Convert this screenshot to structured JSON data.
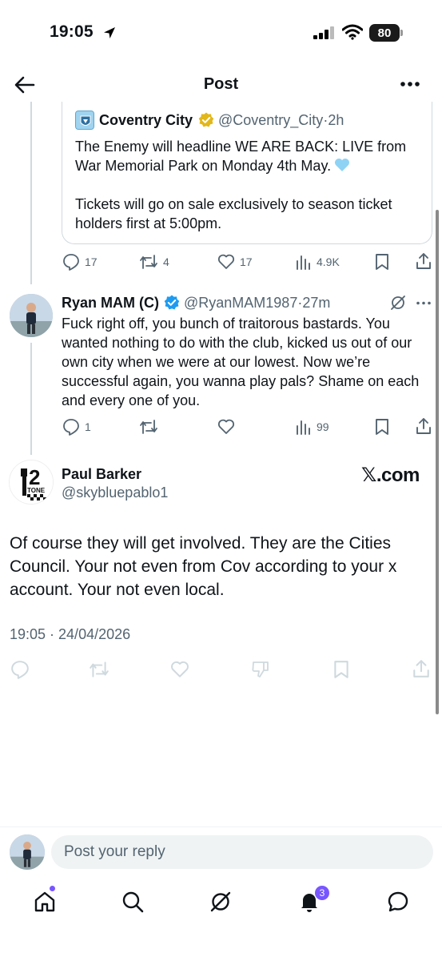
{
  "status_bar": {
    "time": "19:05",
    "battery": "80"
  },
  "header": {
    "title": "Post"
  },
  "quoted_tweet": {
    "name": "Coventry City",
    "handle": "@Coventry_City",
    "age": "2h",
    "paragraph1": "The Enemy will headline WE ARE BACK: LIVE from War Memorial Park on Monday 4th May.",
    "paragraph2": "Tickets will go on sale exclusively to season ticket holders first at 5:00pm."
  },
  "quoted_actions": {
    "replies": "17",
    "reposts": "4",
    "likes": "17",
    "views": "4.9K"
  },
  "reply": {
    "name": "Ryan MAM (C)",
    "handle": "@RyanMAM1987",
    "age": "27m",
    "text": "Fuck right off, you bunch of traitorous bastards. You wanted nothing to do with the club, kicked us out of our own city when we were at our lowest. Now we’re successful again, you wanna play pals? Shame on each and every one of you."
  },
  "reply_actions": {
    "replies": "1",
    "reposts": "",
    "likes": "",
    "views": "99"
  },
  "main_post": {
    "name": "Paul Barker",
    "handle": "@skybluepablo1",
    "avatar_text_top": "2",
    "avatar_text_bottom": "TONE",
    "watermark": "𝕏.com",
    "text": "Of course they will get involved. They are the Cities Council. Your not even from Cov according to your x account. Your not even local.",
    "timestamp": "19:05 · 24/04/2026"
  },
  "reply_bar": {
    "placeholder": "Post your reply"
  },
  "bottom_nav": {
    "notifications_badge": "3"
  },
  "colors": {
    "text": "#0f1419",
    "muted": "#536471",
    "blue_badge": "#1d9bf0",
    "gold_badge": "#e2b719",
    "accent": "#7856ff"
  }
}
